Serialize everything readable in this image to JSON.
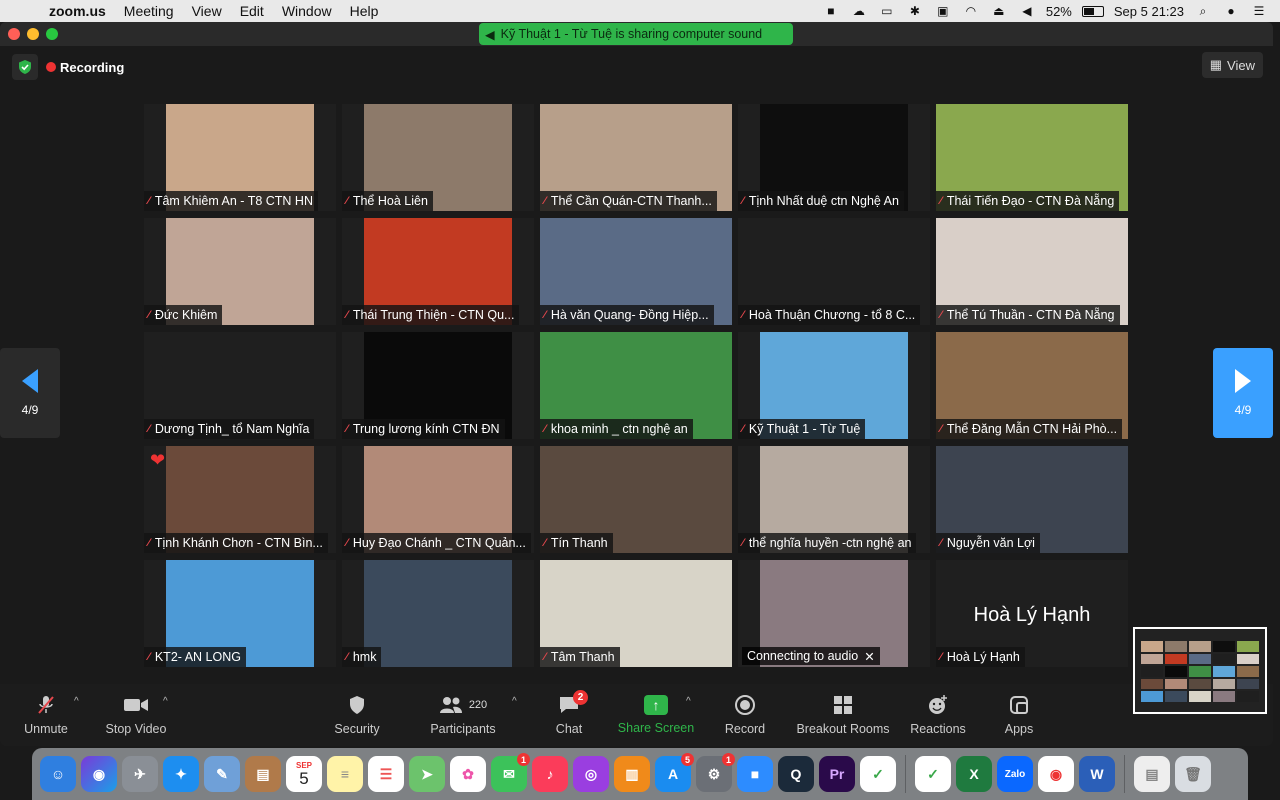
{
  "menubar": {
    "app": "zoom.us",
    "items": [
      "Meeting",
      "View",
      "Edit",
      "Window",
      "Help"
    ],
    "battery": "52%",
    "datetime": "Sep 5  21:23"
  },
  "share_banner": "Kỹ Thuật 1  - Từ Tuệ is sharing computer sound",
  "recording_label": "Recording",
  "view_label": "View",
  "pager": {
    "left": "4/9",
    "right": "4/9"
  },
  "tiles": [
    {
      "name": "Tâm Khiêm An - T8 CTN HN",
      "color": "#c9a78a"
    },
    {
      "name": "Thể Hoà Liên",
      "color": "#8d7a6a"
    },
    {
      "name": "Thể Cần Quán-CTN Thanh...",
      "color": "#b79f8a"
    },
    {
      "name": "Tịnh Nhất duệ ctn Nghệ An",
      "color": "#0e0e0e"
    },
    {
      "name": "Thái Tiến Đạo - CTN Đà Nẵng",
      "color": "#8aa84e"
    },
    {
      "name": "Đức Khiêm",
      "color": "#c0a596"
    },
    {
      "name": "Thái Trung Thiện - CTN Qu...",
      "color": "#c23a22"
    },
    {
      "name": "Hà văn Quang- Đồng Hiệp...",
      "color": "#5a6b86"
    },
    {
      "name": "Hoà Thuận Chương - tổ 8 C...",
      "color": "#1f1f1f"
    },
    {
      "name": "Thể Tú Thuần - CTN Đà Nẵng",
      "color": "#d9cfc8"
    },
    {
      "name": "Dương Tịnh_ tổ Nam Nghĩa",
      "color": "#1f1f1f"
    },
    {
      "name": "Trung lương kính CTN ĐN",
      "color": "#0a0a0a"
    },
    {
      "name": "khoa minh _ ctn nghệ an",
      "color": "#3f8f45"
    },
    {
      "name": "Kỹ Thuật 1  - Từ Tuệ",
      "color": "#5fa7d9"
    },
    {
      "name": "Thể Đăng Mẫn CTN Hải Phò...",
      "color": "#8b6a4a"
    },
    {
      "name": "Tịnh Khánh Chơn - CTN Bìn...",
      "color": "#6b4a3a"
    },
    {
      "name": "Huy Đạo Chánh _ CTN Quản...",
      "color": "#b28a78"
    },
    {
      "name": "Tín Thanh",
      "color": "#5a4a3f"
    },
    {
      "name": "thể nghĩa huyền -ctn nghệ an",
      "color": "#b6aaa0"
    },
    {
      "name": "Nguyễn văn Lợi",
      "color": "#3d4450"
    },
    {
      "name": "KT2- AN LONG",
      "color": "#4d9ad6"
    },
    {
      "name": "hmk",
      "color": "#3b4a5c"
    },
    {
      "name": "Tâm Thanh",
      "color": "#d8d4c8"
    },
    {
      "name": "",
      "color": "#8a7a80",
      "connecting": "Connecting to audio"
    },
    {
      "name": "Hoà Lý Hạnh",
      "color": "#1f1f1f",
      "big": "Hoà Lý Hạnh"
    }
  ],
  "toolbar": {
    "unmute": "Unmute",
    "stop_video": "Stop Video",
    "security": "Security",
    "participants": "Participants",
    "participants_count": "220",
    "chat": "Chat",
    "chat_badge": "2",
    "share_screen": "Share Screen",
    "record": "Record",
    "breakout": "Breakout Rooms",
    "reactions": "Reactions",
    "apps": "Apps"
  },
  "dock": {
    "calendar_month": "SEP",
    "calendar_day": "5",
    "messages_badge": "1",
    "appstore_badge": "5",
    "settings_badge": "1",
    "premiere": "Pr",
    "excel": "X",
    "zalo": "Zalo",
    "word": "W"
  }
}
